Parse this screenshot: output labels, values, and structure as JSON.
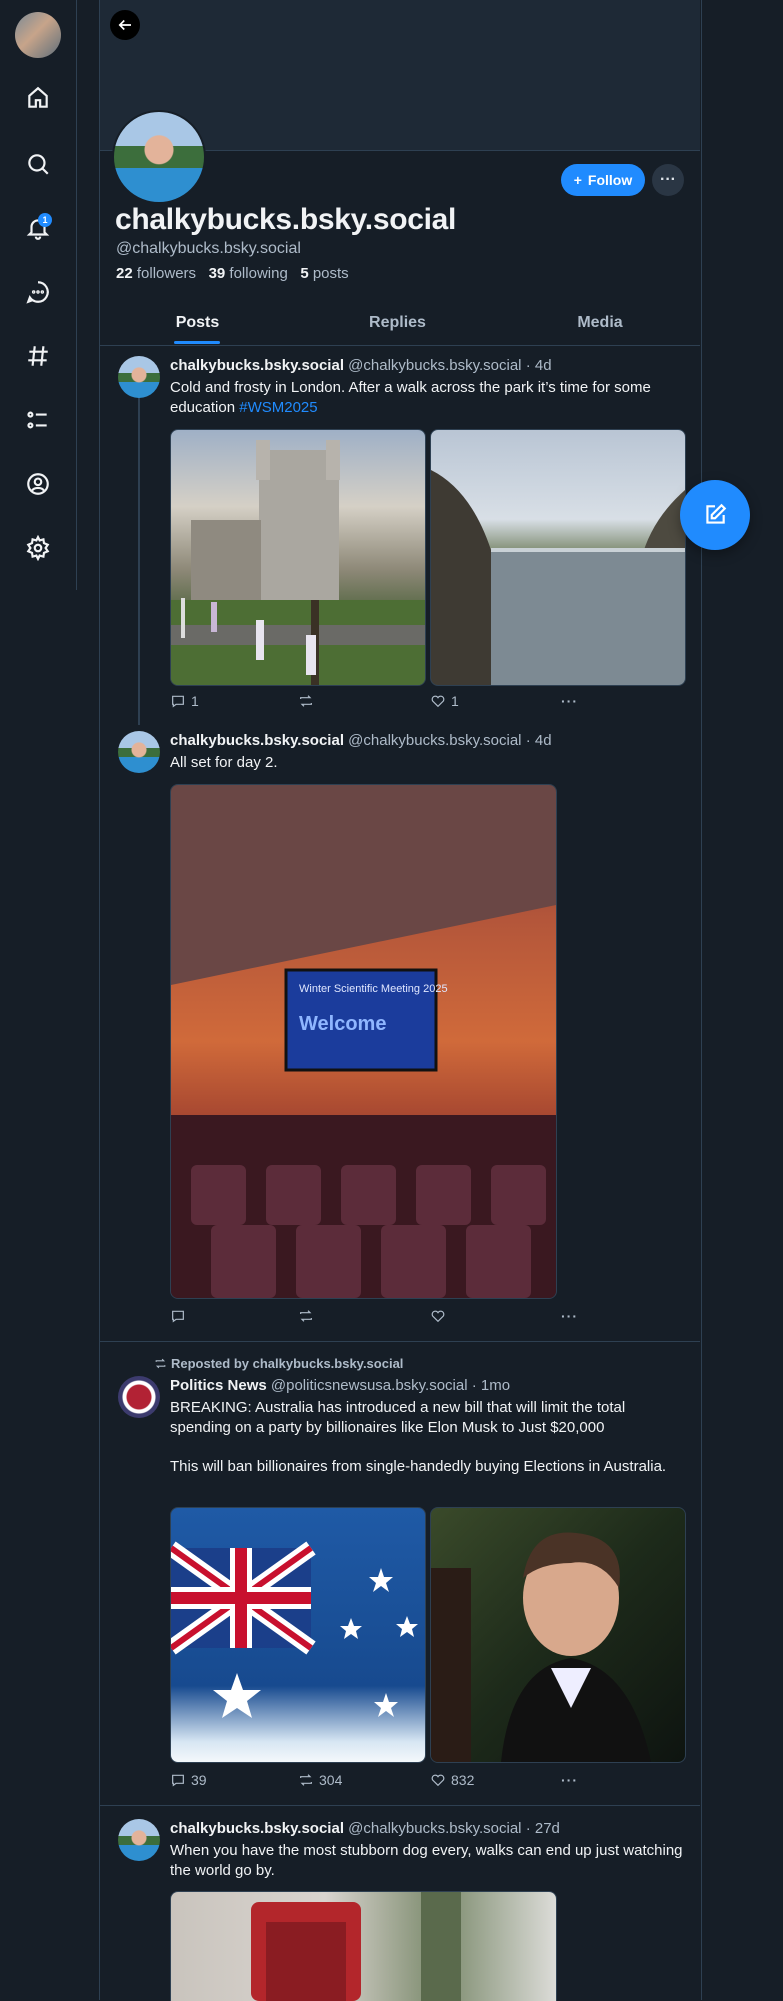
{
  "profile": {
    "display_name": "chalkybucks.bsky.social",
    "handle": "@chalkybucks.bsky.social",
    "followers_count": "22",
    "followers_label": "followers",
    "following_count": "39",
    "following_label": "following",
    "posts_count": "5",
    "posts_label": "posts",
    "follow_label": "Follow",
    "more_label": "···"
  },
  "nav": {
    "notifications_badge": "1",
    "icons": [
      "home-icon",
      "search-icon",
      "bell-icon",
      "chat-icon",
      "hashtag-icon",
      "list-icon",
      "profile-icon",
      "settings-icon"
    ]
  },
  "tabs": [
    "Posts",
    "Replies",
    "Media"
  ],
  "active_tab": "Posts",
  "posts": [
    {
      "author": "chalkybucks.bsky.social",
      "handle": "@chalkybucks.bsky.social",
      "time": "· 4d",
      "text": "Cold and frosty in London. After a walk across the park it’s time for some education ",
      "hashtag": "#WSM2025",
      "replies": "1",
      "reposts": "",
      "likes": "1"
    },
    {
      "author": "chalkybucks.bsky.social",
      "handle": "@chalkybucks.bsky.social",
      "time": "· 4d",
      "text": "All set for day 2.",
      "image_text_title": "Winter Scientific Meeting 2025",
      "image_text_main": "Welcome",
      "replies": "",
      "reposts": "",
      "likes": ""
    },
    {
      "repost_label": "Reposted by chalkybucks.bsky.social",
      "author": "Politics News",
      "handle": "@politicsnewsusa.bsky.social",
      "time": "· 1mo",
      "text_1": "BREAKING: Australia has introduced a new bill that will limit the total spending on a party by billionaires like Elon Musk to Just $20,000",
      "text_2": "This will ban billionaires from single-handedly buying Elections in Australia.",
      "replies": "39",
      "reposts": "304",
      "likes": "832"
    },
    {
      "author": "chalkybucks.bsky.social",
      "handle": "@chalkybucks.bsky.social",
      "time": "· 27d",
      "text": "When you have the most stubborn dog every, walks can end up just watching the world go by."
    }
  ],
  "colors": {
    "background": "#161e27",
    "accent": "#208bfe",
    "border": "#2e4052",
    "muted_text": "#aebbc9"
  }
}
